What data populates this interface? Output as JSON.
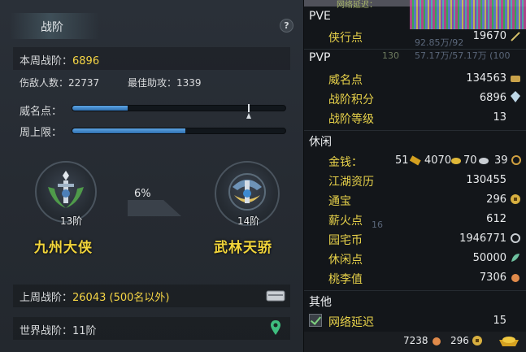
{
  "left": {
    "title": "战阶",
    "help": "?",
    "weekly_label": "本周战阶：",
    "weekly_value": "6896",
    "kills_label": "伤敌人数：",
    "kills_value": "22737",
    "assists_label": "最佳助攻：",
    "assists_value": "1339",
    "fame_label": "威名点：",
    "fame_fill": 0.26,
    "cap_label": "周上限：",
    "cap_fill": 0.53,
    "current_tier": "13阶",
    "current_rank": "九州大侠",
    "progress_pct": "6%",
    "next_tier": "14阶",
    "next_rank": "武林天骄",
    "last_week_label": "上周战阶：",
    "last_week_value": "26043 (500名以外)",
    "world_label": "世界战阶：",
    "world_value": "11阶",
    "icons": [
      "mail-icon",
      "map-pin-icon"
    ]
  },
  "right": {
    "top_fragment": "网络延迟：",
    "pve": {
      "header": "PVE",
      "items": [
        {
          "label": "侠行点",
          "value": "19670",
          "icon": "sword-icon"
        }
      ]
    },
    "pvp": {
      "header": "PVP",
      "items": [
        {
          "label": "威名点",
          "value": "134563",
          "icon": "mask-icon"
        },
        {
          "label": "战阶积分",
          "value": "6896",
          "icon": "crystal-icon"
        },
        {
          "label": "战阶等级",
          "value": "13"
        }
      ]
    },
    "leisure": {
      "header": "休闲",
      "money_label": "金钱：",
      "money": [
        "51",
        "4070",
        "70",
        "39"
      ],
      "items": [
        {
          "label": "江湖资历",
          "value": "130455"
        },
        {
          "label": "通宝",
          "value": "296",
          "icon": "coin-icon"
        },
        {
          "label": "薪火点",
          "value": "612"
        },
        {
          "label": "园宅币",
          "value": "1946771",
          "icon": "house-coin-icon"
        },
        {
          "label": "休闲点",
          "value": "50000",
          "icon": "leaf-icon"
        },
        {
          "label": "桃李值",
          "value": "7306",
          "icon": "peach-icon"
        }
      ]
    },
    "other": {
      "header": "其他",
      "items": [
        {
          "label": "网络延迟",
          "value": "15",
          "checked": true
        }
      ]
    },
    "bottom": {
      "v1": "7238",
      "v2": "296"
    },
    "ghost": {
      "g1": "92.85万/92",
      "g2": "57.17万/57.17万 (100",
      "g3": "130",
      "g4": "16"
    },
    "colors": {
      "accent": "#f5d545",
      "label": "#e8d24a",
      "bar": "#4a90d9"
    }
  }
}
